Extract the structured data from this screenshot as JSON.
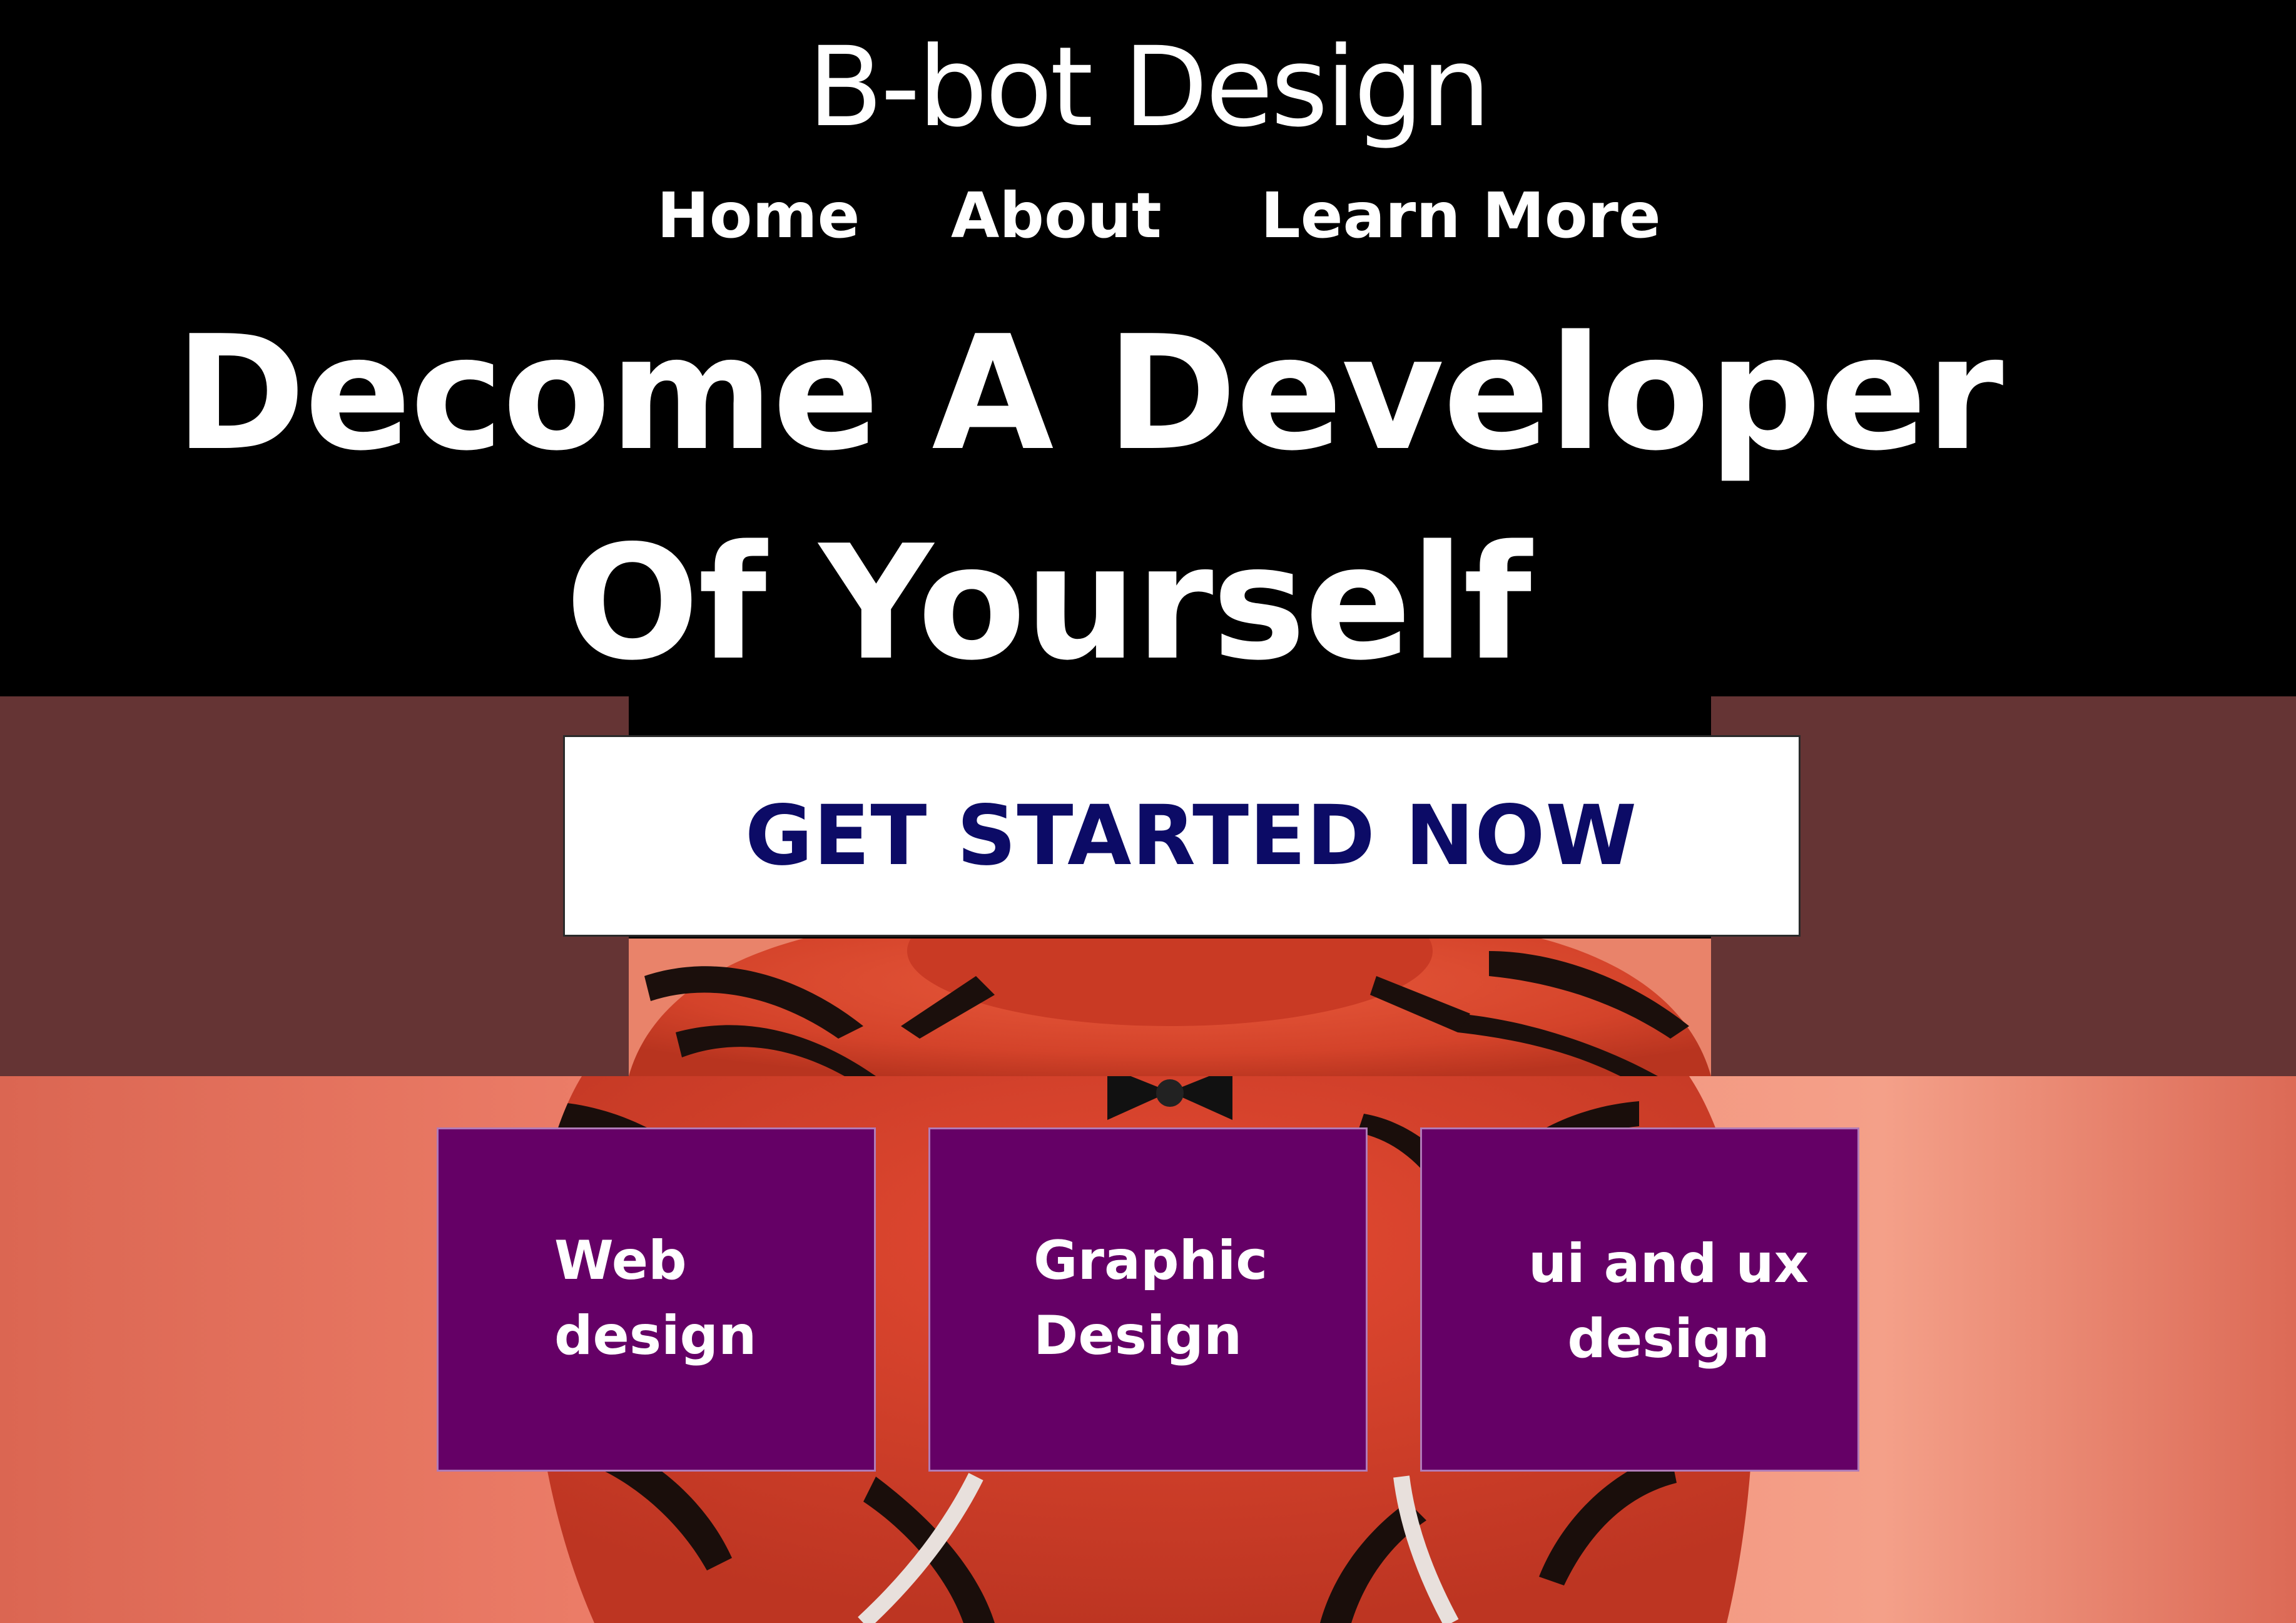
{
  "header": {
    "brand": "B-bot Design",
    "nav": [
      {
        "label": "Home"
      },
      {
        "label": "About"
      },
      {
        "label": "Learn More"
      }
    ]
  },
  "hero": {
    "headline_line1": "Decome A Developer",
    "headline_line2": "Of Yourself",
    "cta_label": "GET STARTED NOW"
  },
  "services": [
    {
      "label": "Web\ndesign"
    },
    {
      "label": "Graphic\nDesign"
    },
    {
      "label": "ui and ux\ndesign"
    }
  ],
  "colors": {
    "header_bg": "#000000",
    "side_panel": "#653434",
    "salmon_bg": "#ee806b",
    "cta_bg": "#ffffff",
    "cta_text": "#0c0b66",
    "card_bg": "#650066",
    "text_light": "#ffffff"
  },
  "icons": {
    "hero_image": "tiger-plush-toy-image"
  }
}
